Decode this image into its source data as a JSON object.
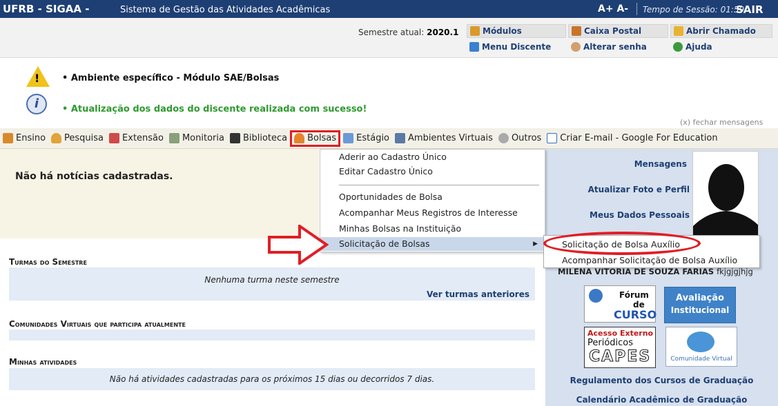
{
  "app": {
    "title_bold": "UFRB - SIGAA -",
    "title_rest": "Sistema de Gestão das Atividades Acadêmicas",
    "font_controls": "A+ A-",
    "session": "Tempo de Sessão: 01:59",
    "exit": "SAIR"
  },
  "header": {
    "semester_label": "Semestre atual:",
    "semester_value": "2020.1",
    "links": {
      "modulos": "Módulos",
      "caixa_postal": "Caixa Postal",
      "abrir_chamado": "Abrir Chamado",
      "menu_discente": "Menu Discente",
      "alterar_senha": "Alterar senha",
      "ajuda": "Ajuda"
    }
  },
  "messages": {
    "warning": "• Ambiente específico - Módulo SAE/Bolsas",
    "success": "• Atualização dos dados do discente realizada com sucesso!",
    "close": "(x) fechar mensagens"
  },
  "menu": {
    "items": [
      "Ensino",
      "Pesquisa",
      "Extensão",
      "Monitoria",
      "Biblioteca",
      "Bolsas",
      "Estágio",
      "Ambientes Virtuais",
      "Outros",
      "Criar E-mail - Google For Education"
    ]
  },
  "dropdown": {
    "items": [
      "Aderir ao Cadastro Único",
      "Editar Cadastro Único",
      "Oportunidades de Bolsa",
      "Acompanhar Meus Registros de Interesse",
      "Minhas Bolsas na Instituição",
      "Solicitação de Bolsas"
    ],
    "submenu": [
      "Solicitação de Bolsa Auxílio",
      "Acompanhar Solicitação de Bolsa Auxílio"
    ]
  },
  "news": "Não há notícias cadastradas.",
  "sections": {
    "turmas_title": "Turmas do Semestre",
    "turmas_empty": "Nenhuma turma neste semestre",
    "turmas_link": "Ver turmas anteriores",
    "comunidades_title": "Comunidades Virtuais que participa atualmente",
    "atividades_title": "Minhas atividades",
    "atividades_empty": "Não há atividades cadastradas para os próximos 15 dias ou decorridos 7 dias."
  },
  "profile": {
    "mensagens": "Mensagens",
    "atualizar": "Atualizar Foto e Perfil",
    "dados": "Meus Dados Pessoais",
    "name": "MILENA VITORIA DE SOUZA FARIAS",
    "name_suffix": "fkjgjgjhjg",
    "forum_top": "Fórum",
    "forum_de": "de",
    "forum_curso": "CURSO",
    "avaliacao_1": "Avaliação",
    "avaliacao_2": "Institucional",
    "capes_1": "Acesso Externo",
    "capes_2": "Periódicos",
    "capes_3": "CAPES",
    "comunidade": "Comunidade Virtual",
    "regulamento": "Regulamento dos Cursos de Graduação",
    "calendario": "Calendário Acadêmico de Graduação"
  },
  "colors": {
    "topbar": "#1e3f74",
    "highlight": "#e01e25",
    "success": "#2f9a2f"
  }
}
